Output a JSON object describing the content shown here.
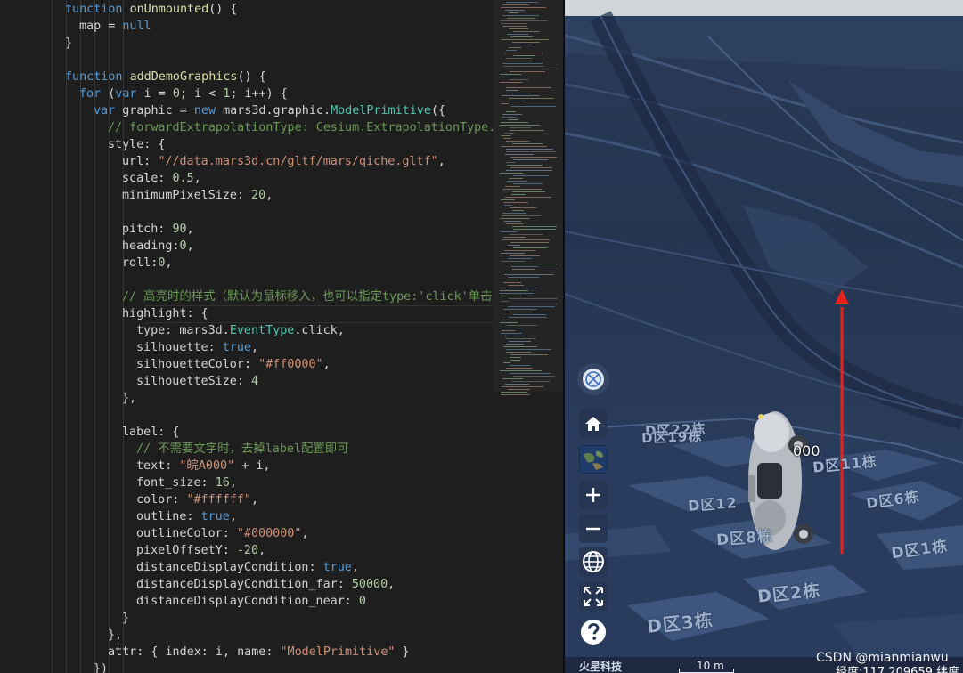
{
  "editor": {
    "lines": [
      [
        [
          "kw",
          "function "
        ],
        [
          "fn",
          "onUnmounted"
        ],
        [
          "txt",
          "() {"
        ]
      ],
      [
        [
          "txt",
          "map = "
        ],
        [
          "kw",
          "null"
        ]
      ],
      [
        [
          "txt",
          "}"
        ]
      ],
      [],
      [
        [
          "kw",
          "function "
        ],
        [
          "fn",
          "addDemoGraphics"
        ],
        [
          "txt",
          "() {"
        ]
      ],
      [
        [
          "kw",
          "for "
        ],
        [
          "txt",
          "("
        ],
        [
          "kw",
          "var "
        ],
        [
          "txt",
          "i = "
        ],
        [
          "num",
          "0"
        ],
        [
          "txt",
          "; i < "
        ],
        [
          "num",
          "1"
        ],
        [
          "txt",
          "; i++) {"
        ]
      ],
      [
        [
          "kw",
          "var "
        ],
        [
          "txt",
          "graphic = "
        ],
        [
          "kw",
          "new "
        ],
        [
          "txt",
          "mars3d.graphic."
        ],
        [
          "cls",
          "ModelPrimitive"
        ],
        [
          "txt",
          "({"
        ]
      ],
      [
        [
          "cmt",
          "// forwardExtrapolationType: Cesium.ExtrapolationType."
        ]
      ],
      [
        [
          "txt",
          "style: {"
        ]
      ],
      [
        [
          "txt",
          "url: "
        ],
        [
          "str",
          "\"//data.mars3d.cn/gltf/mars/qiche.gltf\""
        ],
        [
          "txt",
          ","
        ]
      ],
      [
        [
          "txt",
          "scale: "
        ],
        [
          "num",
          "0.5"
        ],
        [
          "txt",
          ","
        ]
      ],
      [
        [
          "txt",
          "minimumPixelSize: "
        ],
        [
          "num",
          "20"
        ],
        [
          "txt",
          ","
        ]
      ],
      [],
      [
        [
          "txt",
          "pitch: "
        ],
        [
          "num",
          "90"
        ],
        [
          "txt",
          ","
        ]
      ],
      [
        [
          "txt",
          "heading:"
        ],
        [
          "num",
          "0"
        ],
        [
          "txt",
          ","
        ]
      ],
      [
        [
          "txt",
          "roll:"
        ],
        [
          "num",
          "0"
        ],
        [
          "txt",
          ","
        ]
      ],
      [],
      [
        [
          "cmt",
          "// 高亮时的样式（默认为鼠标移入，也可以指定type:'click'单击"
        ]
      ],
      [
        [
          "txt",
          "highlight: {"
        ]
      ],
      [
        [
          "txt",
          "type: mars3d."
        ],
        [
          "cls",
          "EventType"
        ],
        [
          "txt",
          ".click,"
        ]
      ],
      [
        [
          "txt",
          "silhouette: "
        ],
        [
          "kw",
          "true"
        ],
        [
          "txt",
          ","
        ]
      ],
      [
        [
          "txt",
          "silhouetteColor: "
        ],
        [
          "str",
          "\"#ff0000\""
        ],
        [
          "txt",
          ","
        ]
      ],
      [
        [
          "txt",
          "silhouetteSize: "
        ],
        [
          "num",
          "4"
        ]
      ],
      [
        [
          "txt",
          "},"
        ]
      ],
      [],
      [
        [
          "txt",
          "label: {"
        ]
      ],
      [
        [
          "cmt",
          "// 不需要文字时，去掉label配置即可"
        ]
      ],
      [
        [
          "txt",
          "text: "
        ],
        [
          "str",
          "\"皖A000\""
        ],
        [
          "txt",
          " + i,"
        ]
      ],
      [
        [
          "txt",
          "font_size: "
        ],
        [
          "num",
          "16"
        ],
        [
          "txt",
          ","
        ]
      ],
      [
        [
          "txt",
          "color: "
        ],
        [
          "str",
          "\"#ffffff\""
        ],
        [
          "txt",
          ","
        ]
      ],
      [
        [
          "txt",
          "outline: "
        ],
        [
          "kw",
          "true"
        ],
        [
          "txt",
          ","
        ]
      ],
      [
        [
          "txt",
          "outlineColor: "
        ],
        [
          "str",
          "\"#000000\""
        ],
        [
          "txt",
          ","
        ]
      ],
      [
        [
          "txt",
          "pixelOffsetY: "
        ],
        [
          "num",
          "-20"
        ],
        [
          "txt",
          ","
        ]
      ],
      [
        [
          "txt",
          "distanceDisplayCondition: "
        ],
        [
          "kw",
          "true"
        ],
        [
          "txt",
          ","
        ]
      ],
      [
        [
          "txt",
          "distanceDisplayCondition_far: "
        ],
        [
          "num",
          "50000"
        ],
        [
          "txt",
          ","
        ]
      ],
      [
        [
          "txt",
          "distanceDisplayCondition_near: "
        ],
        [
          "num",
          "0"
        ]
      ],
      [
        [
          "txt",
          "}"
        ]
      ],
      [
        [
          "txt",
          "},"
        ]
      ],
      [
        [
          "txt",
          "attr: { index: i, name: "
        ],
        [
          "str",
          "\"ModelPrimitive\""
        ],
        [
          "txt",
          " }"
        ]
      ],
      [
        [
          "txt",
          "})"
        ]
      ]
    ]
  },
  "map": {
    "district_labels": [
      {
        "text": "D区19栋",
        "name": "label-d19"
      },
      {
        "text": "D区22栋",
        "name": "label-d22"
      },
      {
        "text": "D区11栋",
        "name": "label-d11"
      },
      {
        "text": "D区12",
        "name": "label-d12"
      },
      {
        "text": "D区6栋",
        "name": "label-d6"
      },
      {
        "text": "D区8栋",
        "name": "label-d8"
      },
      {
        "text": "D区1栋",
        "name": "label-d1"
      },
      {
        "text": "D区2栋",
        "name": "label-d2"
      },
      {
        "text": "D区3栋",
        "name": "label-d3"
      }
    ],
    "model_label": "000",
    "watermark": "CSDN @mianmianwu",
    "brand": "火星科技",
    "scale": "10 m",
    "coords": "经度:117.209659    纬度"
  },
  "toolbar": {
    "icons": [
      "compass-icon",
      "home-icon",
      "basemap-icon",
      "zoom-in-icon",
      "zoom-out-icon",
      "globe-icon",
      "fullscreen-icon",
      "help-icon"
    ]
  },
  "colors": {
    "arrow": "#e8231c",
    "map_bg": "#243552",
    "editor_bg": "#1e1e1e"
  }
}
